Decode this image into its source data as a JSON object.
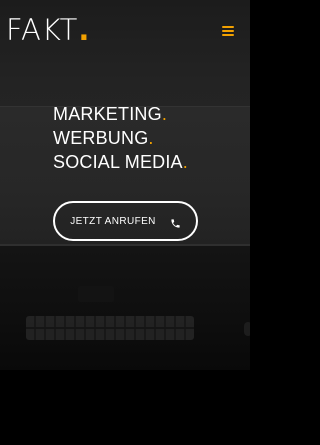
{
  "header": {
    "logo_text": "FAKT",
    "logo_dot": ".",
    "menu_icon": "hamburger-menu-icon"
  },
  "hero": {
    "lines": [
      {
        "text": "MARKETING",
        "dot": "."
      },
      {
        "text": "WERBUNG",
        "dot": "."
      },
      {
        "text": "SOCIAL MEDIA",
        "dot": "."
      }
    ],
    "cta": {
      "label": "JETZT ANRUFEN",
      "icon": "phone-icon"
    }
  },
  "colors": {
    "accent": "#f2a100",
    "text": "#ffffff",
    "background": "#000000"
  }
}
